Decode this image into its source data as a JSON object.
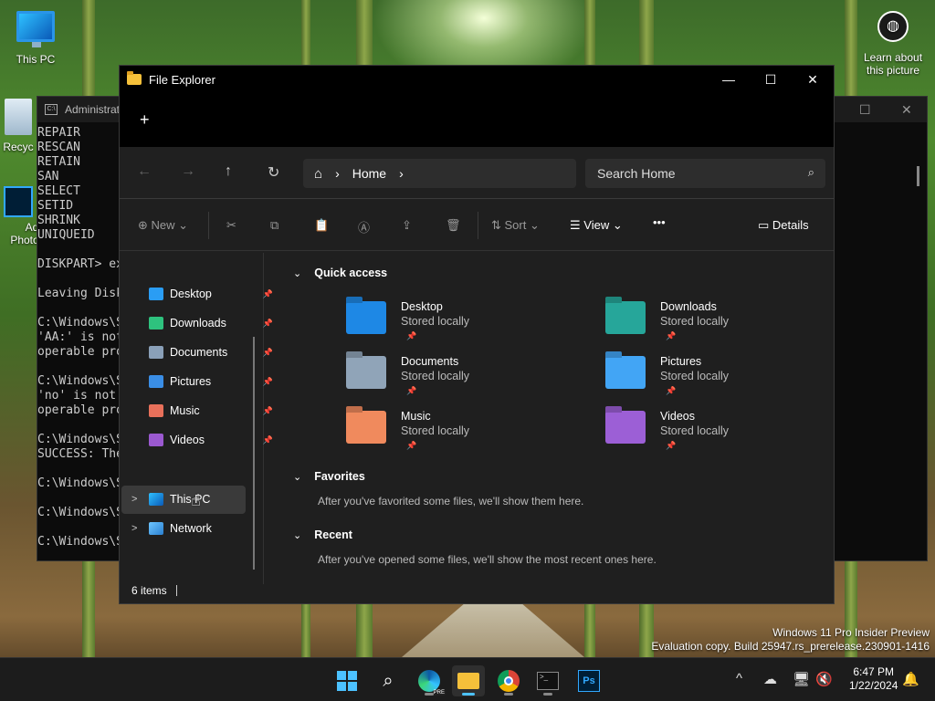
{
  "desktop": {
    "icons": [
      {
        "label": "This PC",
        "icon": "monitor-icon"
      },
      {
        "label": "Recyc",
        "icon": "recycle-bin-icon"
      },
      {
        "label": "Ad",
        "icon": "photoshop-icon"
      },
      {
        "label": "Photo",
        "icon": "photoshop-icon"
      }
    ],
    "learn": {
      "line1": "Learn about",
      "line2": "this picture",
      "icon": "camera-icon"
    },
    "watermark": {
      "line1": "Windows 11 Pro Insider Preview",
      "line2": "Evaluation copy. Build 25947.rs_prerelease.230901-1416"
    }
  },
  "cmd": {
    "title": "Administrati",
    "icon_label": "C:\\",
    "lines": [
      "REPAIR",
      "RESCAN",
      "RETAIN",
      "SAN",
      "SELECT",
      "SETID",
      "SHRINK",
      "UNIQUEID",
      "",
      "DISKPART> ex",
      "",
      "Leaving Disk",
      "",
      "C:\\Windows\\S",
      "'AA:' is not",
      "operable pro",
      "",
      "C:\\Windows\\S",
      "'no' is not",
      "operable pro",
      "",
      "C:\\Windows\\S",
      "SUCCESS: The",
      "",
      "C:\\Windows\\S",
      "",
      "C:\\Windows\\S",
      "",
      "C:\\Windows\\S"
    ]
  },
  "explorer": {
    "title": "File Explorer",
    "controls": {
      "minimize": "—",
      "maximize": "☐",
      "close": "✕"
    },
    "new_tab": "+",
    "nav": {
      "back": "←",
      "forward": "→",
      "up": "↑",
      "refresh": "↻"
    },
    "address": {
      "home_icon": "home-icon",
      "sep": "›",
      "crumb": "Home"
    },
    "search": {
      "placeholder": "Search Home",
      "icon": "⌕"
    },
    "commandbar": {
      "new": "New",
      "sort": "Sort",
      "view": "View",
      "more": "•••",
      "details": "Details"
    },
    "sidebar": {
      "pinned": [
        {
          "label": "Desktop",
          "color": "#2a9df4"
        },
        {
          "label": "Downloads",
          "color": "#2ec27e"
        },
        {
          "label": "Documents",
          "color": "#8aa0b8"
        },
        {
          "label": "Pictures",
          "color": "#3a8ee6"
        },
        {
          "label": "Music",
          "color": "#e8705a"
        },
        {
          "label": "Videos",
          "color": "#9b59d0"
        }
      ],
      "pin_glyph": "📌",
      "this_pc": "This PC",
      "network": "Network",
      "chevron": ">"
    },
    "quick_access": {
      "heading": "Quick access",
      "items": [
        {
          "name": "Desktop",
          "sub": "Stored locally",
          "color": "#1e88e5"
        },
        {
          "name": "Downloads",
          "sub": "Stored locally",
          "color": "#26a69a"
        },
        {
          "name": "Documents",
          "sub": "Stored locally",
          "color": "#90a4b8"
        },
        {
          "name": "Pictures",
          "sub": "Stored locally",
          "color": "#42a5f5"
        },
        {
          "name": "Music",
          "sub": "Stored locally",
          "color": "#f08a5d"
        },
        {
          "name": "Videos",
          "sub": "Stored locally",
          "color": "#9c5fd6"
        }
      ]
    },
    "favorites": {
      "heading": "Favorites",
      "message": "After you've favorited some files, we'll show them here."
    },
    "recent": {
      "heading": "Recent",
      "message": "After you've opened some files, we'll show the most recent ones here."
    },
    "status": "6 items"
  },
  "taskbar": {
    "apps": [
      "start-icon",
      "search-icon",
      "edge-pre-icon",
      "file-explorer-icon",
      "chrome-icon",
      "terminal-icon",
      "photoshop-icon"
    ],
    "ps_label": "Ps",
    "edge_badge": "PRE",
    "tray": {
      "chevron": "^"
    },
    "clock": {
      "time": "6:47 PM",
      "date": "1/22/2024"
    }
  }
}
